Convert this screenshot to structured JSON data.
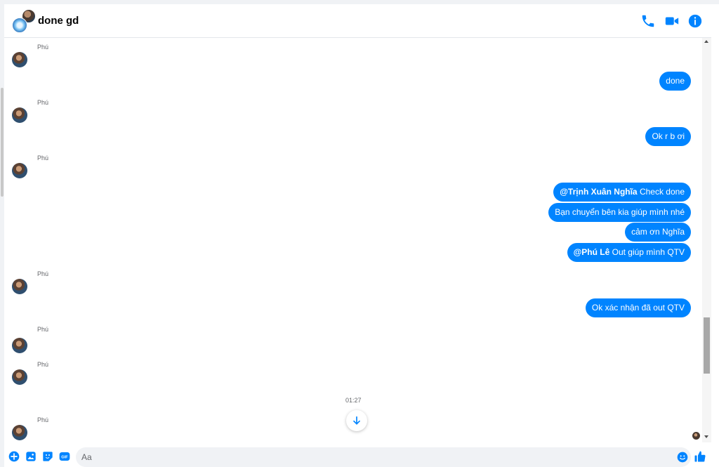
{
  "header": {
    "title": "done gd",
    "icons": [
      "phone-icon",
      "video-call-icon",
      "info-icon"
    ]
  },
  "messages": {
    "sender_names": [
      "Phú",
      "Phú",
      "Phú",
      "Phú",
      "Phú",
      "Phú",
      "Phú"
    ],
    "sent": [
      {
        "text": "done"
      },
      {
        "text": "Ok r b ơi"
      },
      {
        "mention": "@Trịnh Xuân Nghĩa",
        "text": " Check done"
      },
      {
        "text": "Bạn chuyển bên kia giúp mình nhé"
      },
      {
        "text": "cảm ơn Nghĩa"
      },
      {
        "mention": "@Phú Lê",
        "text": " Out giúp mình QTV"
      },
      {
        "text": "Ok xác nhận đã out QTV"
      }
    ],
    "timestamp": "01:27"
  },
  "composer": {
    "placeholder": "Aa",
    "icons": [
      "add-icon",
      "image-icon",
      "sticker-icon",
      "gif-icon",
      "emoji-icon",
      "like-icon"
    ],
    "gif_label": "GIF"
  },
  "colors": {
    "accent": "#0084ff",
    "bubble_text": "#ffffff",
    "secondary_text": "#65676b"
  }
}
